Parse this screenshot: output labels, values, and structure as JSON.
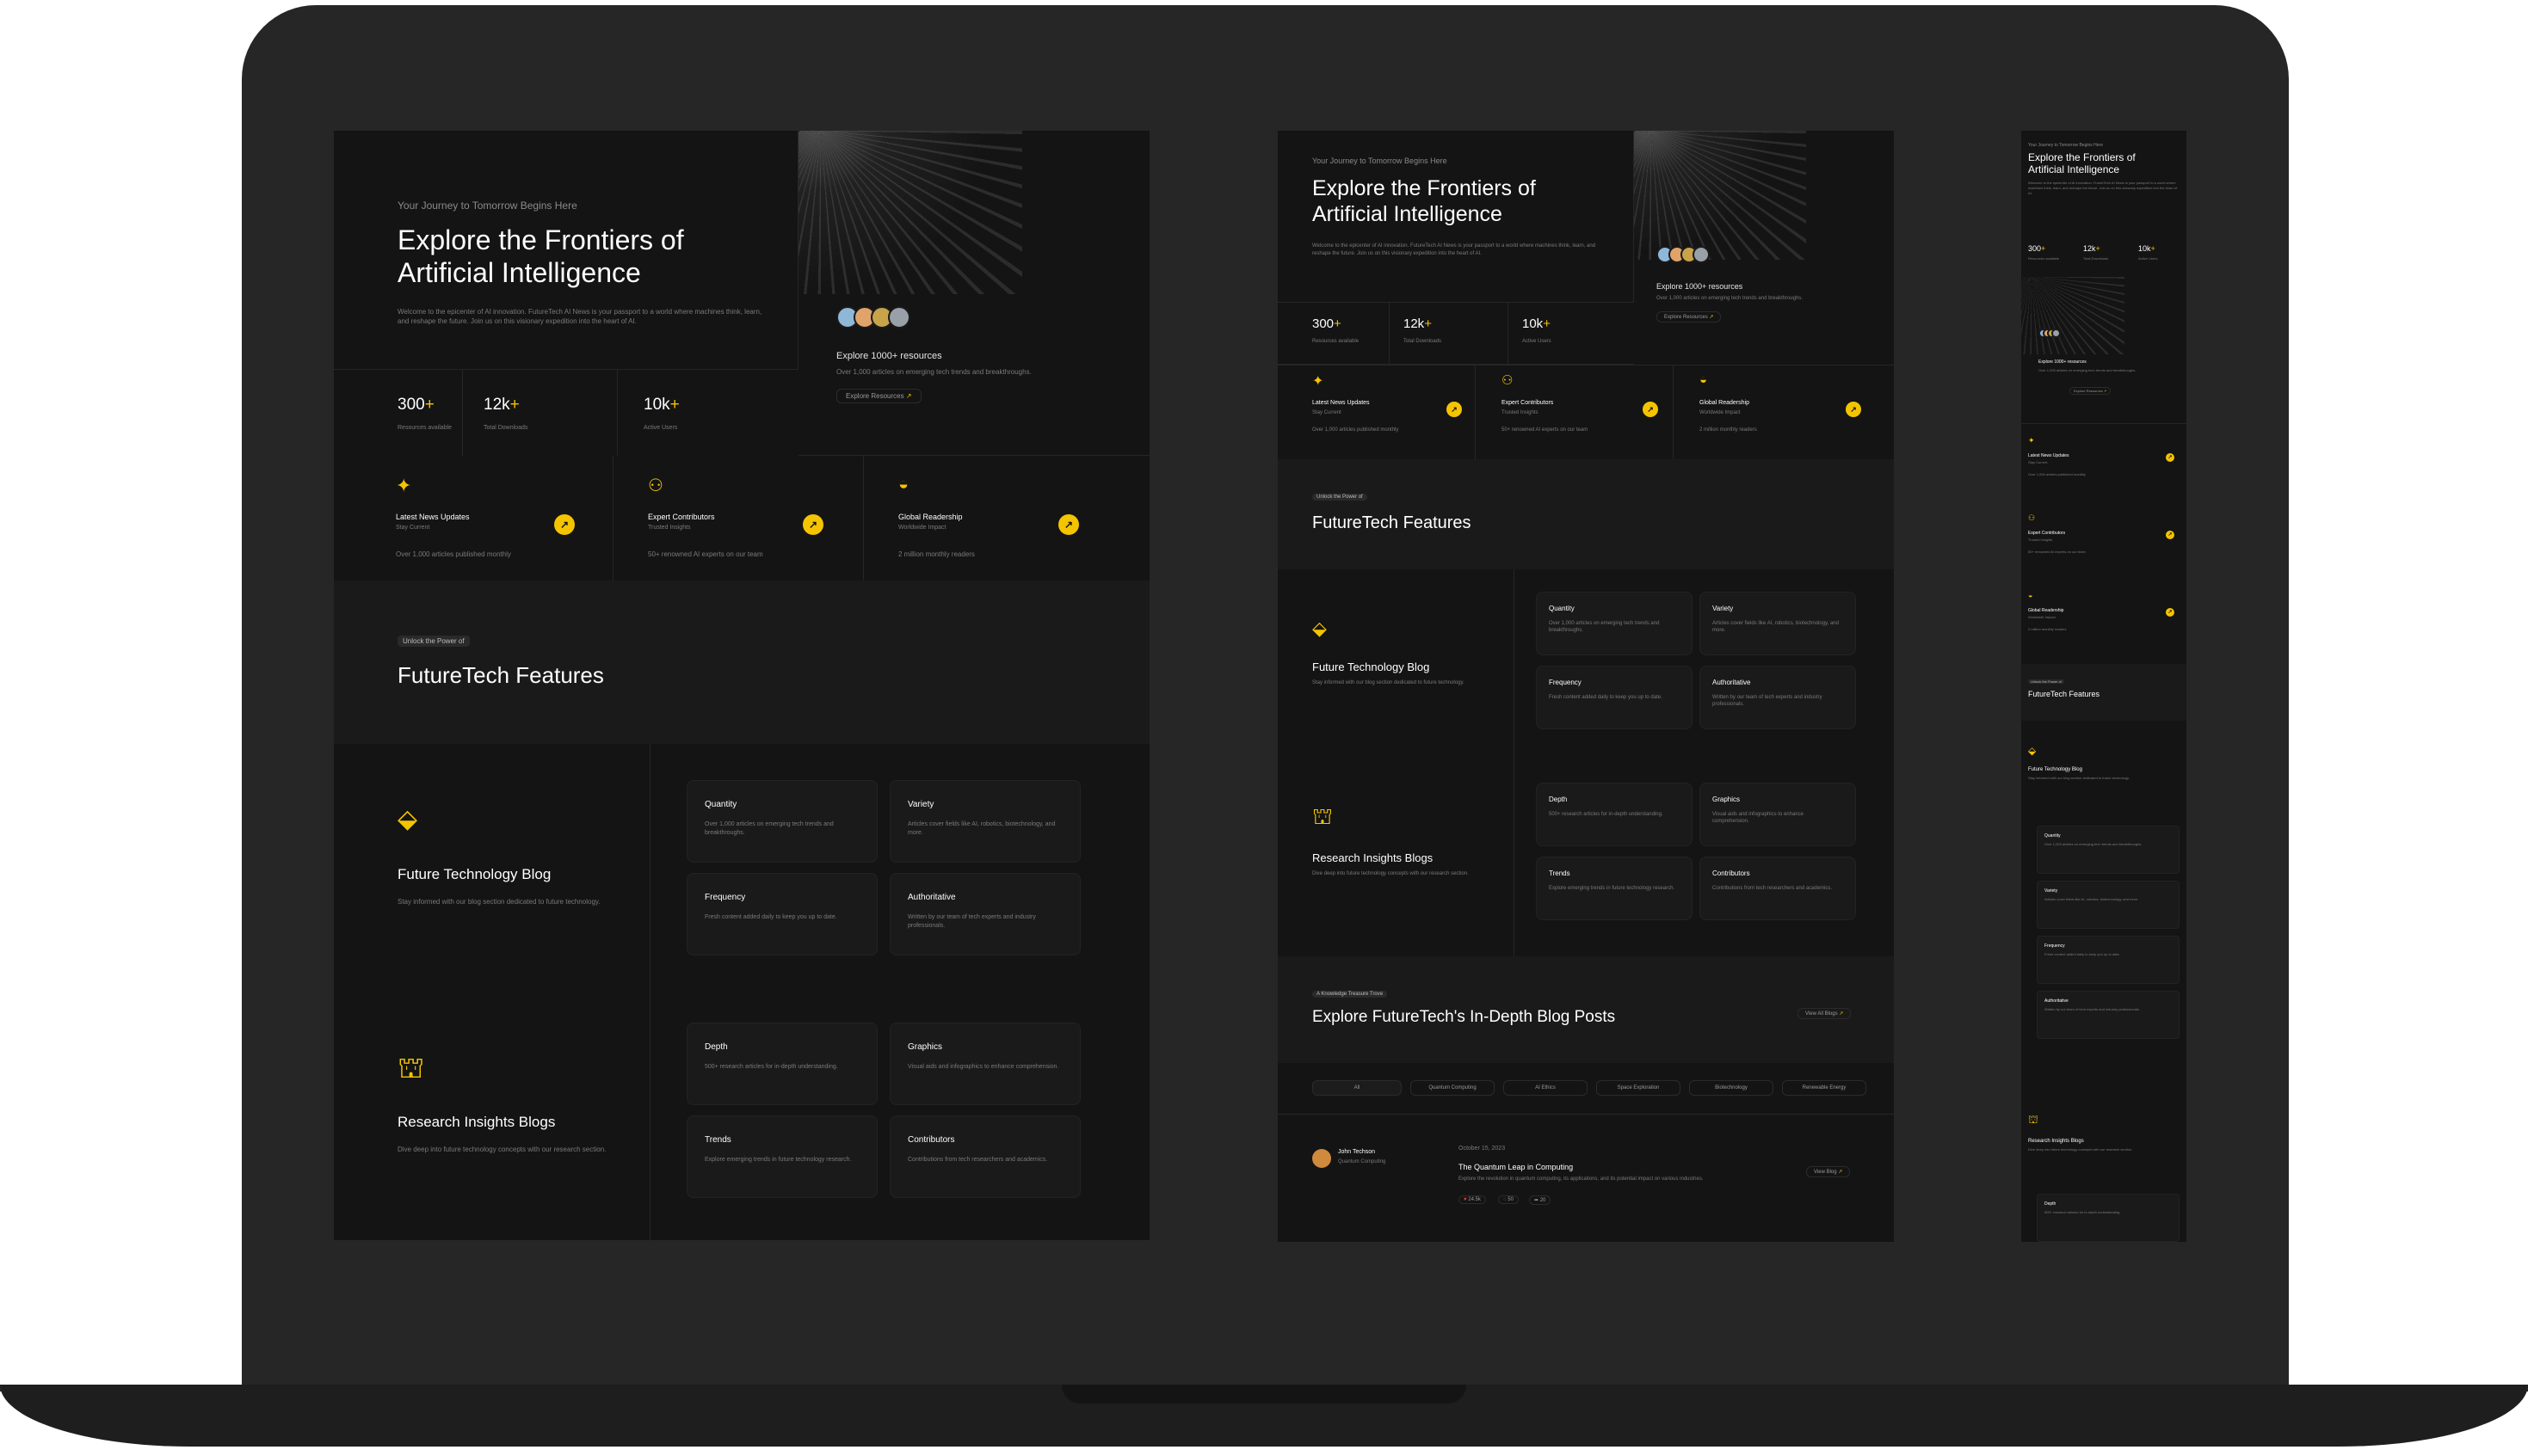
{
  "kicker": "Your Journey to Tomorrow Begins Here",
  "hero_title_line1": "Explore the Frontiers of",
  "hero_title_line2": "Artificial Intelligence",
  "hero_desc": "Welcome to the epicenter of AI innovation. FutureTech AI News is your passport to a world where machines think, learn, and reshape the future. Join us on this visionary expedition into the heart of AI.",
  "explore": {
    "title": "Explore 1000+ resources",
    "desc": "Over 1,000 articles on emerging tech trends and breakthroughs.",
    "link": "Explore Resources"
  },
  "stats": [
    {
      "value": "300",
      "suffix": "+",
      "label": "Resources available"
    },
    {
      "value": "12k",
      "suffix": "+",
      "label": "Total Downloads"
    },
    {
      "value": "10k",
      "suffix": "+",
      "label": "Active Users"
    }
  ],
  "highlights": [
    {
      "title": "Latest News Updates",
      "sub": "Stay Current",
      "desc": "Over 1,000 articles published monthly"
    },
    {
      "title": "Expert Contributors",
      "sub": "Trusted Insights",
      "desc": "50+ renowned AI experts on our team"
    },
    {
      "title": "Global Readership",
      "sub": "Worldwide Impact",
      "desc": "2 million monthly readers"
    }
  ],
  "features": {
    "badge": "Unlock the Power of",
    "title": "FutureTech Features",
    "blocks": [
      {
        "title": "Future Technology Blog",
        "desc": "Stay informed with our blog section dedicated to future technology.",
        "cards": [
          {
            "title": "Quantity",
            "desc": "Over 1,000 articles on emerging tech trends and breakthroughs."
          },
          {
            "title": "Variety",
            "desc": "Articles cover fields like AI, robotics, biotechnology, and more."
          },
          {
            "title": "Frequency",
            "desc": "Fresh content added daily to keep you up to date."
          },
          {
            "title": "Authoritative",
            "desc": "Written by our team of tech experts and industry professionals."
          }
        ]
      },
      {
        "title": "Research Insights Blogs",
        "desc": "Dive deep into future technology concepts with our research section.",
        "cards": [
          {
            "title": "Depth",
            "desc": "500+ research articles for in-depth understanding."
          },
          {
            "title": "Graphics",
            "desc": "Visual aids and infographics to enhance comprehension."
          },
          {
            "title": "Trends",
            "desc": "Explore emerging trends in future technology research."
          },
          {
            "title": "Contributors",
            "desc": "Contributions from tech researchers and academics."
          }
        ]
      }
    ]
  },
  "blog": {
    "badge": "A Knowledge Treasure Trove",
    "title": "Explore FutureTech's In-Depth Blog Posts",
    "view_all": "View All Blogs",
    "tabs": [
      "All",
      "Quantum Computing",
      "AI Ethics",
      "Space Exploration",
      "Biotechnology",
      "Renewable Energy"
    ],
    "post": {
      "author": "John Techson",
      "role": "Quantum Computing",
      "date": "October 15, 2023",
      "title": "The Quantum Leap in Computing",
      "desc": "Explore the revolution in quantum computing, its applications, and its potential impact on various industries.",
      "likes": "24.5k",
      "comments": "50",
      "shares": "20",
      "link": "View Blog"
    }
  },
  "colors": {
    "accent": "#F5C400",
    "bg": "#141414",
    "panel": "#1A1A1A",
    "border": "#262626"
  }
}
